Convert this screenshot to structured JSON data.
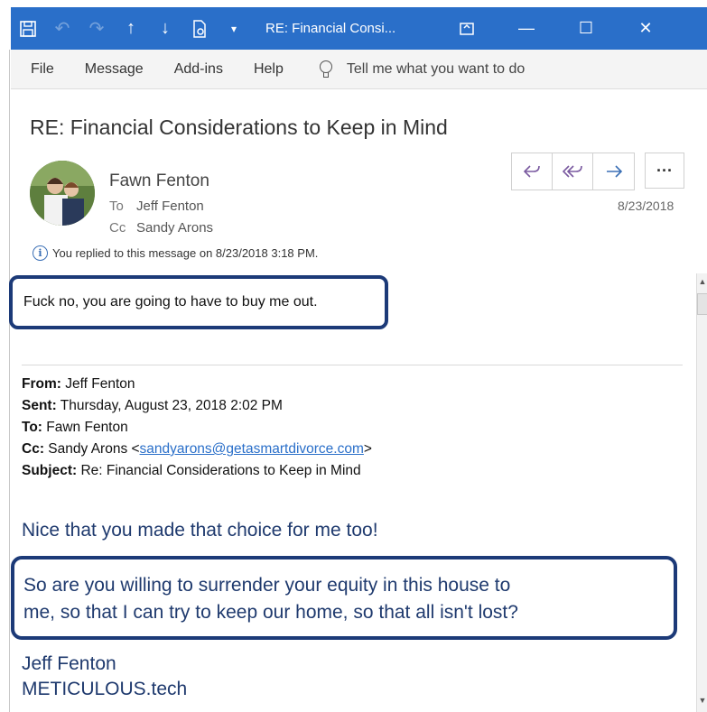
{
  "window": {
    "title": "RE: Financial Consi...",
    "icons": [
      "save-icon",
      "undo-icon",
      "redo-icon",
      "up-arrow-icon",
      "down-arrow-icon",
      "attach-icon",
      "customize-icon"
    ],
    "accent_color": "#2a6fc9"
  },
  "menu": {
    "items": [
      "File",
      "Message",
      "Add-ins",
      "Help"
    ],
    "tell_me": "Tell me what you want to do"
  },
  "message": {
    "subject": "RE: Financial Considerations to Keep in Mind",
    "sender": "Fawn Fenton",
    "to_label": "To",
    "to": "Jeff Fenton",
    "cc_label": "Cc",
    "cc": "Sandy Arons",
    "date": "8/23/2018",
    "info": "You replied to this message on 8/23/2018 3:18 PM.",
    "actions": [
      "reply-icon",
      "reply-all-icon",
      "forward-icon",
      "more-icon"
    ]
  },
  "body": {
    "reply_text": "Fuck no, you are going to have to buy me out.",
    "quoted_header": {
      "from_label": "From:",
      "from": "Jeff Fenton",
      "sent_label": "Sent:",
      "sent": "Thursday, August 23, 2018 2:02 PM",
      "to_label": "To:",
      "to": "Fawn Fenton",
      "cc_label": "Cc:",
      "cc_name": "Sandy Arons <",
      "cc_email": "sandyarons@getasmartdivorce.com",
      "cc_close": ">",
      "subject_label": "Subject:",
      "subject": "Re: Financial Considerations to Keep in Mind"
    },
    "quote_line1": "Nice that you made that choice for me too!",
    "quote_line2a": "So are you willing to surrender your equity in this house to",
    "quote_line2b": "me, so that I can try to keep our home, so that all isn't lost?",
    "signature_name": "Jeff Fenton",
    "signature_site": "METICULOUS.tech"
  }
}
